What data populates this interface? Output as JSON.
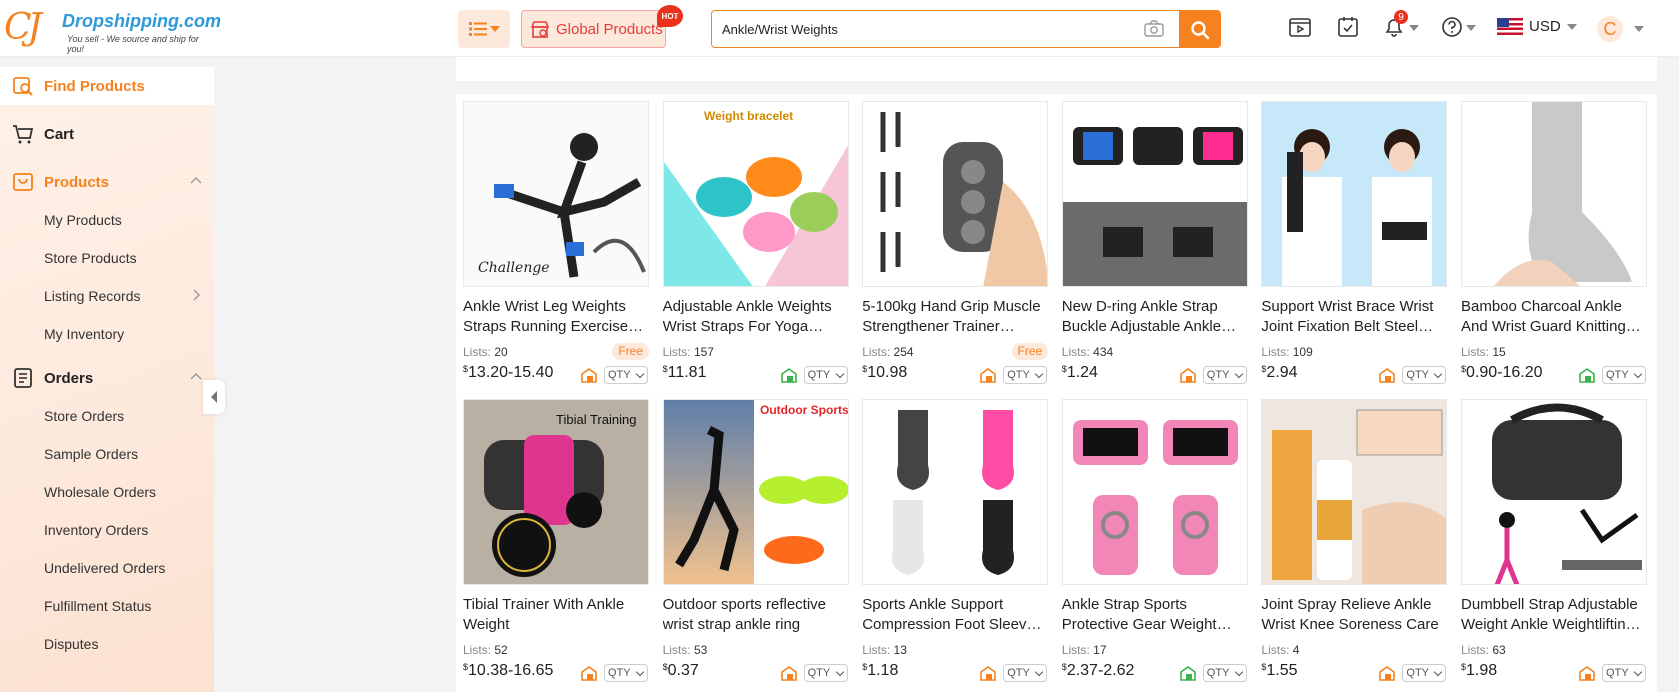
{
  "header": {
    "logo_name": "Dropshipping.com",
    "logo_tagline": "You sell - We source and ship for you!",
    "global_products_label": "Global Products",
    "hot_badge": "HOT",
    "search_value": "Ankle/Wrist Weights",
    "notification_count": "9",
    "currency": "USD",
    "avatar_letter": "C",
    "accent_color": "#f5821f"
  },
  "sidebar": {
    "find_products": "Find Products",
    "cart": "Cart",
    "products": "Products",
    "products_items": [
      "My Products",
      "Store Products",
      "Listing Records",
      "My Inventory"
    ],
    "orders": "Orders",
    "orders_items": [
      "Store Orders",
      "Sample Orders",
      "Wholesale Orders",
      "Inventory Orders",
      "Undelivered Orders",
      "Fulfillment Status",
      "Disputes"
    ]
  },
  "products": [
    {
      "title": "Ankle Wrist Leg Weights Straps Running Exercise Gym Sports",
      "lists_label": "Lists:",
      "lists": "20",
      "free": "Free",
      "currency_symbol": "$",
      "price": "13.20-15.40",
      "qty": "QTY",
      "ship_color": "#f5821f",
      "thumb_text": "Challenge"
    },
    {
      "title": "Adjustable Ankle Weights Wrist Straps For Yoga Fitness",
      "lists_label": "Lists:",
      "lists": "157",
      "free": "",
      "currency_symbol": "$",
      "price": "11.81",
      "qty": "QTY",
      "ship_color": "#3bb24a",
      "thumb_text": "Weight bracelet"
    },
    {
      "title": "5-100kg Hand Grip Muscle Strengthener Trainer Adjustable",
      "lists_label": "Lists:",
      "lists": "254",
      "free": "Free",
      "currency_symbol": "$",
      "price": "10.98",
      "qty": "QTY",
      "ship_color": "#f5821f",
      "thumb_text": ""
    },
    {
      "title": "New D-ring Ankle Strap Buckle Adjustable Ankle Cuff",
      "lists_label": "Lists:",
      "lists": "434",
      "free": "",
      "currency_symbol": "$",
      "price": "1.24",
      "qty": "QTY",
      "ship_color": "#f5821f",
      "thumb_text": ""
    },
    {
      "title": "Support Wrist Brace Wrist Joint Fixation Belt Steel Plate",
      "lists_label": "Lists:",
      "lists": "109",
      "free": "",
      "currency_symbol": "$",
      "price": "2.94",
      "qty": "QTY",
      "ship_color": "#f5821f",
      "thumb_text": ""
    },
    {
      "title": "Bamboo Charcoal Ankle And Wrist Guard Knitting Ankle Support",
      "lists_label": "Lists:",
      "lists": "15",
      "free": "",
      "currency_symbol": "$",
      "price": "0.90-16.20",
      "qty": "QTY",
      "ship_color": "#3bb24a",
      "thumb_text": ""
    },
    {
      "title": "Tibial Trainer With Ankle Weight",
      "lists_label": "Lists:",
      "lists": "52",
      "free": "",
      "currency_symbol": "$",
      "price": "10.38-16.65",
      "qty": "QTY",
      "ship_color": "#f5821f",
      "thumb_text": "Tibial Training"
    },
    {
      "title": "Outdoor sports reflective wrist strap ankle ring",
      "lists_label": "Lists:",
      "lists": "53",
      "free": "",
      "currency_symbol": "$",
      "price": "0.37",
      "qty": "QTY",
      "ship_color": "#f5821f",
      "thumb_text": "Outdoor Sports"
    },
    {
      "title": "Sports Ankle Support Compression Foot Sleeve Socks",
      "lists_label": "Lists:",
      "lists": "13",
      "free": "",
      "currency_symbol": "$",
      "price": "1.18",
      "qty": "QTY",
      "ship_color": "#f5821f",
      "thumb_text": ""
    },
    {
      "title": "Ankle Strap Sports Protective Gear Weight Lifting",
      "lists_label": "Lists:",
      "lists": "17",
      "free": "",
      "currency_symbol": "$",
      "price": "2.37-2.62",
      "qty": "QTY",
      "ship_color": "#3bb24a",
      "thumb_text": ""
    },
    {
      "title": "Joint Spray Relieve Ankle Wrist Knee Soreness Care",
      "lists_label": "Lists:",
      "lists": "4",
      "free": "",
      "currency_symbol": "$",
      "price": "1.55",
      "qty": "QTY",
      "ship_color": "#f5821f",
      "thumb_text": ""
    },
    {
      "title": "Dumbbell Strap Adjustable Weight Ankle Weightlifting Belt",
      "lists_label": "Lists:",
      "lists": "63",
      "free": "",
      "currency_symbol": "$",
      "price": "1.98",
      "qty": "QTY",
      "ship_color": "#f5821f",
      "thumb_text": ""
    }
  ]
}
